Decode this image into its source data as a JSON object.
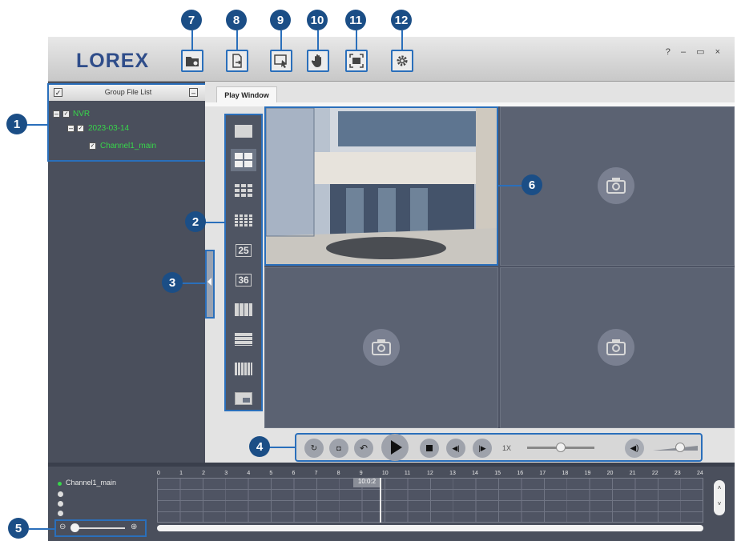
{
  "app": {
    "logo": "LOREX",
    "window_controls": "? – ▭ ×"
  },
  "callouts": [
    "1",
    "2",
    "3",
    "4",
    "5",
    "6",
    "7",
    "8",
    "9",
    "10",
    "11",
    "12"
  ],
  "toolbar": [
    {
      "icon": "folder-open-icon"
    },
    {
      "icon": "export-icon"
    },
    {
      "icon": "select-icon"
    },
    {
      "icon": "hand-icon"
    },
    {
      "icon": "fullscreen-icon"
    },
    {
      "icon": "gear-icon"
    }
  ],
  "file_list": {
    "header": "Group File List",
    "tree": [
      "NVR",
      "2023-03-14",
      "Channel1_main"
    ]
  },
  "tab": {
    "label": "Play Window"
  },
  "grid_layouts": [
    "1",
    "4",
    "9",
    "16",
    "25",
    "36",
    "8",
    "13",
    "16b",
    "PIP"
  ],
  "playback": {
    "speed": "1X",
    "speed_level": 0.5,
    "volume_level": 0.6
  },
  "timeline": {
    "channel": "Channel1_main",
    "marker": "10:0:2",
    "hours": [
      "0",
      "1",
      "2",
      "3",
      "4",
      "5",
      "6",
      "7",
      "8",
      "9",
      "10",
      "11",
      "12",
      "13",
      "14",
      "15",
      "16",
      "17",
      "18",
      "19",
      "20",
      "21",
      "22",
      "23",
      "24"
    ]
  },
  "colors": {
    "accent": "#2a6fbb",
    "callout": "#1b4e86",
    "tree_text": "#37d64a",
    "logo": "#2f4d8a"
  }
}
